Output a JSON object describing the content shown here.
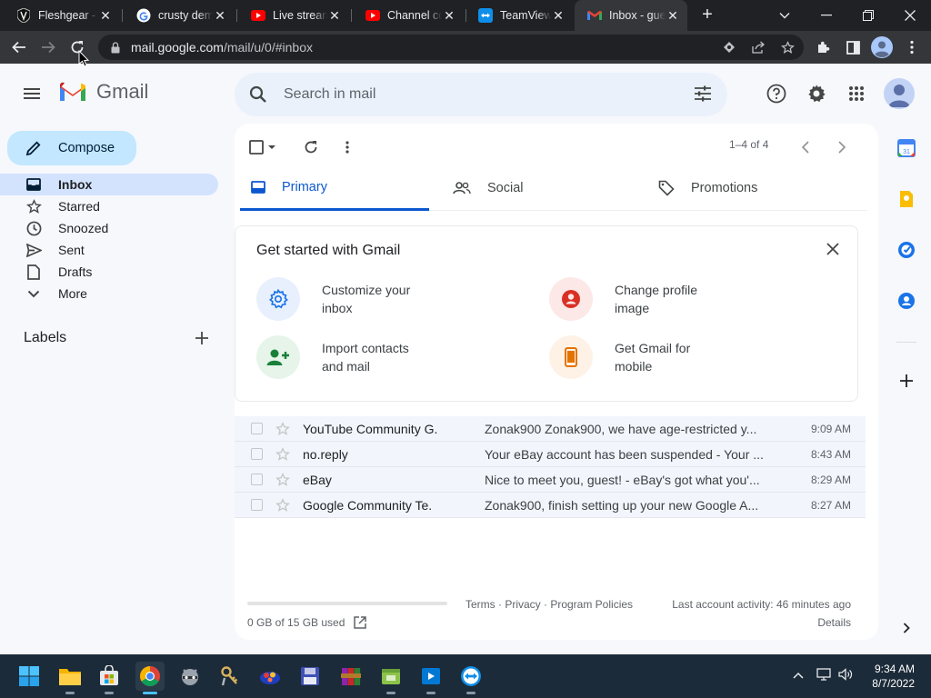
{
  "browser": {
    "tabs": [
      {
        "title": "Fleshgear - ",
        "icon": "shield-favicon"
      },
      {
        "title": "crusty demo",
        "icon": "google-favicon"
      },
      {
        "title": "Live stream",
        "icon": "youtube-favicon"
      },
      {
        "title": "Channel co",
        "icon": "youtube-favicon"
      },
      {
        "title": "TeamViewer",
        "icon": "teamviewer-favicon"
      },
      {
        "title": "Inbox - gue",
        "icon": "gmail-favicon"
      }
    ],
    "url_host": "mail.google.com",
    "url_path": "/mail/u/0/#inbox"
  },
  "gmail": {
    "app_name": "Gmail",
    "search_placeholder": "Search in mail",
    "compose_label": "Compose",
    "nav": [
      {
        "label": "Inbox",
        "icon": "inbox-icon",
        "active": true
      },
      {
        "label": "Starred",
        "icon": "star-icon"
      },
      {
        "label": "Snoozed",
        "icon": "clock-icon"
      },
      {
        "label": "Sent",
        "icon": "send-icon"
      },
      {
        "label": "Drafts",
        "icon": "draft-icon"
      },
      {
        "label": "More",
        "icon": "chevron-down-icon"
      }
    ],
    "labels_heading": "Labels",
    "pagination": "1–4 of 4",
    "tabs": [
      {
        "label": "Primary",
        "active": true
      },
      {
        "label": "Social"
      },
      {
        "label": "Promotions"
      }
    ],
    "get_started": {
      "title": "Get started with Gmail",
      "items": [
        {
          "label_1": "Customize your",
          "label_2": "inbox",
          "icon": "settings-icon"
        },
        {
          "label_1": "Change profile",
          "label_2": "image",
          "icon": "profile-icon"
        },
        {
          "label_1": "Import contacts",
          "label_2": "and mail",
          "icon": "add-contact-icon"
        },
        {
          "label_1": "Get Gmail for",
          "label_2": "mobile",
          "icon": "phone-icon"
        }
      ]
    },
    "emails": [
      {
        "from": "YouTube Community G.",
        "subject": "Zonak900 Zonak900, we have age-restricted y...",
        "date": "9:09 AM"
      },
      {
        "from": "no.reply",
        "subject": "Your eBay account has been suspended - Your ...",
        "date": "8:43 AM"
      },
      {
        "from": "eBay",
        "subject": "Nice to meet you, guest! - eBay's got what you'...",
        "date": "8:29 AM"
      },
      {
        "from": "Google Community Te.",
        "subject": "Zonak900, finish setting up your new Google A...",
        "date": "8:27 AM"
      }
    ],
    "storage": "0 GB of 15 GB used",
    "storage_fraction": 0,
    "footer_terms": "Terms · Privacy · Program Policies",
    "last_activity": "Last account activity: 46 minutes ago",
    "details": "Details"
  },
  "taskbar": {
    "time": "9:34 AM",
    "date": "8/7/2022"
  },
  "colors": {
    "accent": "#0b57d0",
    "compose_bg": "#c2e7ff",
    "active_nav": "#d3e3fd"
  }
}
